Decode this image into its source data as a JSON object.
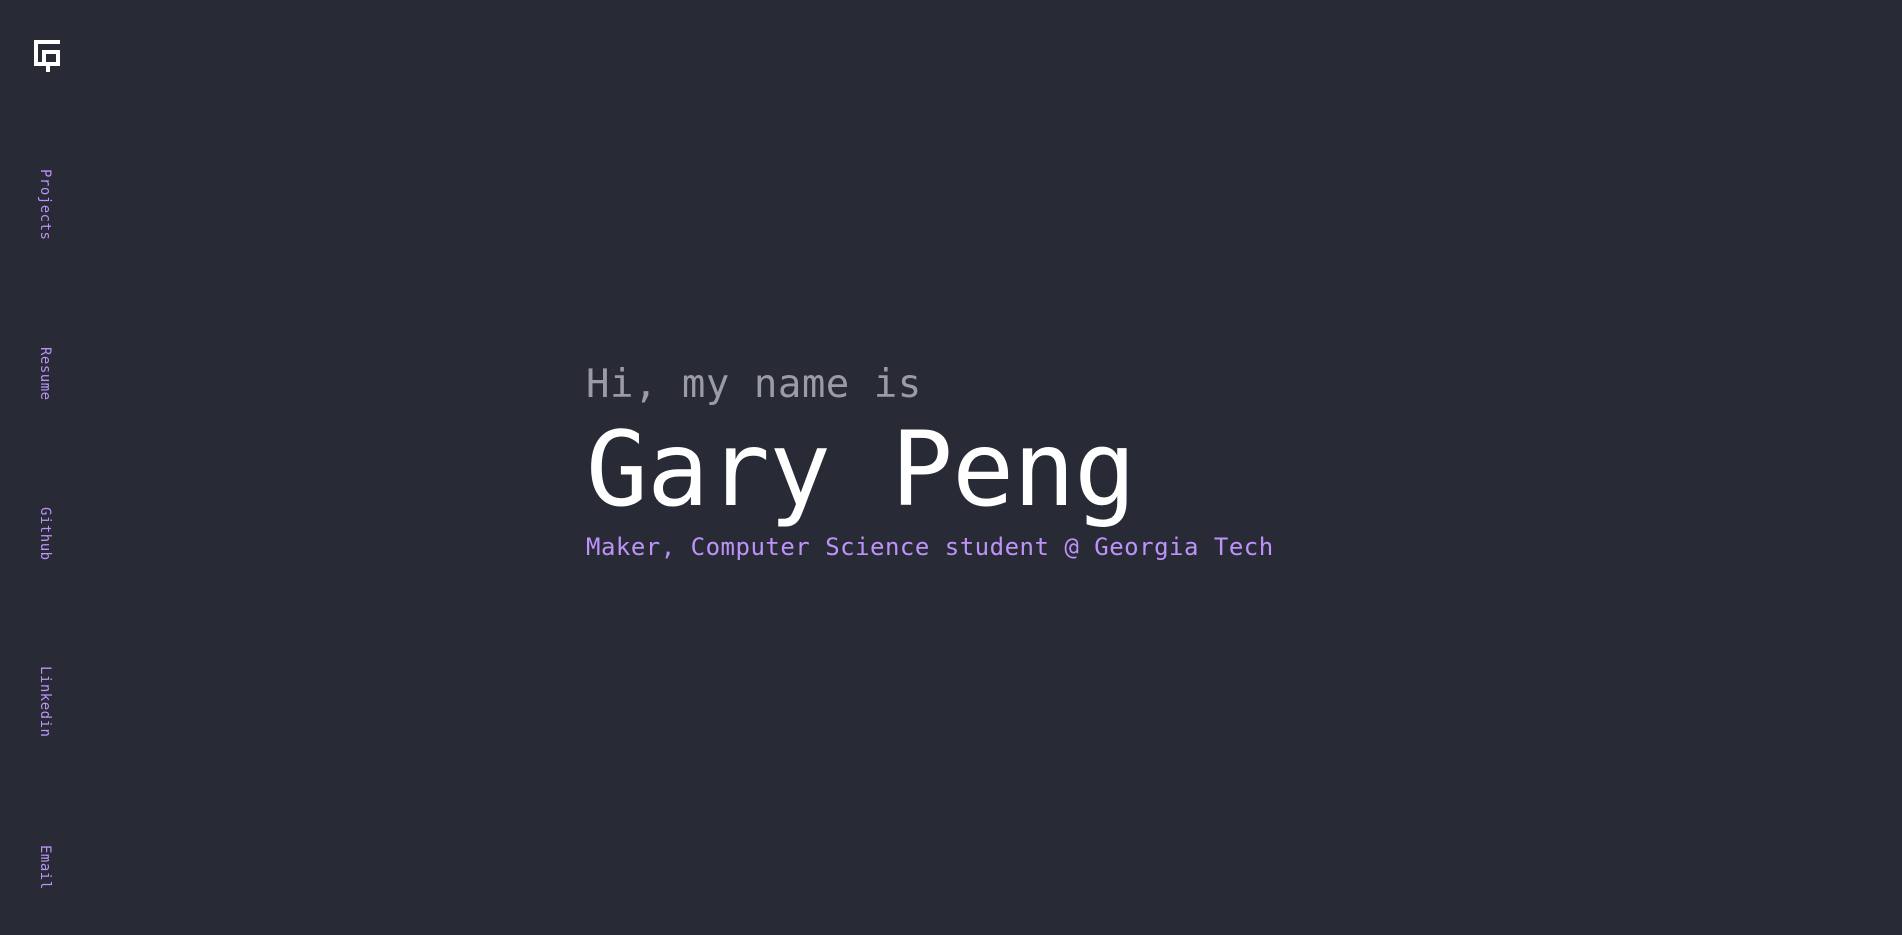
{
  "colors": {
    "background": "#282a36",
    "accent": "#bd93f9",
    "foreground": "#ffffff",
    "muted": "#9a9aa8"
  },
  "logo": {
    "icon": "gp-monogram-logo-icon"
  },
  "nav": {
    "items": [
      {
        "label": "Projects"
      },
      {
        "label": "Resume"
      },
      {
        "label": "Github"
      },
      {
        "label": "Linkedin"
      },
      {
        "label": "Email"
      }
    ]
  },
  "hero": {
    "greeting": "Hi, my name is",
    "name": "Gary Peng",
    "tagline": "Maker, Computer Science student @ Georgia Tech"
  }
}
